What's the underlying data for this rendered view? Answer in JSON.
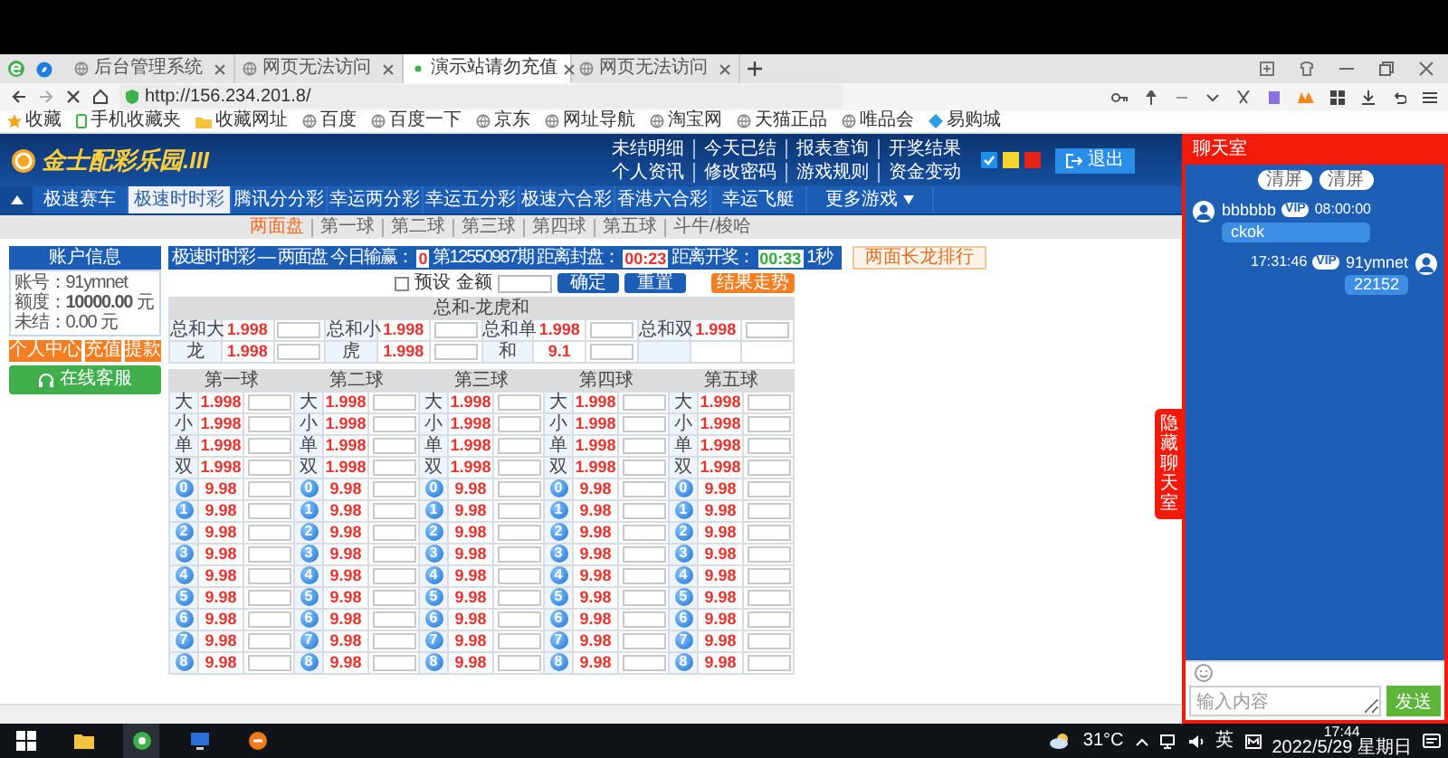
{
  "browser": {
    "tabs": [
      {
        "title": "后台管理系统",
        "selected": false
      },
      {
        "title": "网页无法访问",
        "selected": false
      },
      {
        "title": "演示站请勿充值",
        "selected": true
      },
      {
        "title": "网页无法访问",
        "selected": false
      }
    ],
    "url": "http://156.234.201.8/",
    "bookmarks": [
      "收藏",
      "手机收藏夹",
      "收藏网址",
      "百度",
      "百度一下",
      "京东",
      "网址导航",
      "淘宝网",
      "天猫正品",
      "唯品会",
      "易购城"
    ]
  },
  "header": {
    "logo": "金士配彩乐园.III",
    "links": [
      [
        "未结明细",
        "今天已结",
        "报表查询",
        "开奖结果"
      ],
      [
        "个人资讯",
        "修改密码",
        "游戏规则",
        "资金变动"
      ]
    ],
    "themes": [
      {
        "color": "#1e8fe8",
        "selected": true
      },
      {
        "color": "#f5d631",
        "selected": false
      },
      {
        "color": "#e2231a",
        "selected": false
      }
    ],
    "logout": "退出"
  },
  "nav": [
    {
      "label": "极速赛车",
      "kind": "link",
      "selected": false
    },
    {
      "label": "极速时时彩",
      "kind": "link",
      "selected": true
    },
    {
      "label": "腾讯分分彩",
      "kind": "link",
      "selected": false
    },
    {
      "label": "幸运两分彩",
      "kind": "link",
      "selected": false
    },
    {
      "label": "幸运五分彩",
      "kind": "link",
      "selected": false
    },
    {
      "label": "极速六合彩",
      "kind": "link",
      "selected": false
    },
    {
      "label": "香港六合彩",
      "kind": "link",
      "selected": false
    },
    {
      "label": "幸运飞艇",
      "kind": "link",
      "selected": false
    },
    {
      "label": "更多游戏",
      "kind": "dropdown",
      "selected": false
    }
  ],
  "subnav": [
    {
      "label": "两面盘",
      "selected": true
    },
    {
      "label": "第一球",
      "selected": false
    },
    {
      "label": "第二球",
      "selected": false
    },
    {
      "label": "第三球",
      "selected": false
    },
    {
      "label": "第四球",
      "selected": false
    },
    {
      "label": "第五球",
      "selected": false
    },
    {
      "label": "斗牛/梭哈",
      "selected": false
    }
  ],
  "account": {
    "title": "账户信息",
    "fields": [
      "账号：91ymnet",
      "额度：**10000.00** 元",
      "未结：0.00 元"
    ],
    "buttons": [
      "个人中心",
      "充值",
      "提款"
    ],
    "service": "在线客服"
  },
  "game": {
    "title": "极速时时彩 — 两面盘",
    "today_label": "今日输赢：",
    "today_value": "0",
    "period": "第12550987期 距离封盘：",
    "close_timer": "00:23",
    "draw_label": "距离开奖：",
    "draw_timer": "00:33",
    "refresh": "1秒",
    "ranking_button": "两面长龙排行",
    "preset": {
      "label": "预设",
      "checked": false
    },
    "amount_label": "金额",
    "confirm": "确定",
    "reset": "重置",
    "trend": "结果走势"
  },
  "sum_table": {
    "title": "总和-龙虎和",
    "rows": [
      [
        {
          "label": "总和大",
          "odds": "1.998"
        },
        {
          "label": "总和小",
          "odds": "1.998"
        },
        {
          "label": "总和单",
          "odds": "1.998"
        },
        {
          "label": "总和双",
          "odds": "1.998"
        }
      ],
      [
        {
          "label": "龙",
          "odds": "1.998"
        },
        {
          "label": "虎",
          "odds": "1.998"
        },
        {
          "label": "和",
          "odds": "9.1"
        }
      ]
    ]
  },
  "balls": [
    {
      "title": "第一球",
      "rows": [
        {
          "kind": "text",
          "label": "大",
          "odds": "1.998"
        },
        {
          "kind": "text",
          "label": "小",
          "odds": "1.998"
        },
        {
          "kind": "text",
          "label": "单",
          "odds": "1.998"
        },
        {
          "kind": "text",
          "label": "双",
          "odds": "1.998"
        },
        {
          "kind": "ball",
          "label": "0",
          "odds": "9.98"
        },
        {
          "kind": "ball",
          "label": "1",
          "odds": "9.98"
        },
        {
          "kind": "ball",
          "label": "2",
          "odds": "9.98"
        },
        {
          "kind": "ball",
          "label": "3",
          "odds": "9.98"
        },
        {
          "kind": "ball",
          "label": "4",
          "odds": "9.98"
        },
        {
          "kind": "ball",
          "label": "5",
          "odds": "9.98"
        },
        {
          "kind": "ball",
          "label": "6",
          "odds": "9.98"
        },
        {
          "kind": "ball",
          "label": "7",
          "odds": "9.98"
        },
        {
          "kind": "ball",
          "label": "8",
          "odds": "9.98"
        }
      ]
    },
    {
      "title": "第二球",
      "rows": [
        {
          "kind": "text",
          "label": "大",
          "odds": "1.998"
        },
        {
          "kind": "text",
          "label": "小",
          "odds": "1.998"
        },
        {
          "kind": "text",
          "label": "单",
          "odds": "1.998"
        },
        {
          "kind": "text",
          "label": "双",
          "odds": "1.998"
        },
        {
          "kind": "ball",
          "label": "0",
          "odds": "9.98"
        },
        {
          "kind": "ball",
          "label": "1",
          "odds": "9.98"
        },
        {
          "kind": "ball",
          "label": "2",
          "odds": "9.98"
        },
        {
          "kind": "ball",
          "label": "3",
          "odds": "9.98"
        },
        {
          "kind": "ball",
          "label": "4",
          "odds": "9.98"
        },
        {
          "kind": "ball",
          "label": "5",
          "odds": "9.98"
        },
        {
          "kind": "ball",
          "label": "6",
          "odds": "9.98"
        },
        {
          "kind": "ball",
          "label": "7",
          "odds": "9.98"
        },
        {
          "kind": "ball",
          "label": "8",
          "odds": "9.98"
        }
      ]
    },
    {
      "title": "第三球",
      "rows": [
        {
          "kind": "text",
          "label": "大",
          "odds": "1.998"
        },
        {
          "kind": "text",
          "label": "小",
          "odds": "1.998"
        },
        {
          "kind": "text",
          "label": "单",
          "odds": "1.998"
        },
        {
          "kind": "text",
          "label": "双",
          "odds": "1.998"
        },
        {
          "kind": "ball",
          "label": "0",
          "odds": "9.98"
        },
        {
          "kind": "ball",
          "label": "1",
          "odds": "9.98"
        },
        {
          "kind": "ball",
          "label": "2",
          "odds": "9.98"
        },
        {
          "kind": "ball",
          "label": "3",
          "odds": "9.98"
        },
        {
          "kind": "ball",
          "label": "4",
          "odds": "9.98"
        },
        {
          "kind": "ball",
          "label": "5",
          "odds": "9.98"
        },
        {
          "kind": "ball",
          "label": "6",
          "odds": "9.98"
        },
        {
          "kind": "ball",
          "label": "7",
          "odds": "9.98"
        },
        {
          "kind": "ball",
          "label": "8",
          "odds": "9.98"
        }
      ]
    },
    {
      "title": "第四球",
      "rows": [
        {
          "kind": "text",
          "label": "大",
          "odds": "1.998"
        },
        {
          "kind": "text",
          "label": "小",
          "odds": "1.998"
        },
        {
          "kind": "text",
          "label": "单",
          "odds": "1.998"
        },
        {
          "kind": "text",
          "label": "双",
          "odds": "1.998"
        },
        {
          "kind": "ball",
          "label": "0",
          "odds": "9.98"
        },
        {
          "kind": "ball",
          "label": "1",
          "odds": "9.98"
        },
        {
          "kind": "ball",
          "label": "2",
          "odds": "9.98"
        },
        {
          "kind": "ball",
          "label": "3",
          "odds": "9.98"
        },
        {
          "kind": "ball",
          "label": "4",
          "odds": "9.98"
        },
        {
          "kind": "ball",
          "label": "5",
          "odds": "9.98"
        },
        {
          "kind": "ball",
          "label": "6",
          "odds": "9.98"
        },
        {
          "kind": "ball",
          "label": "7",
          "odds": "9.98"
        },
        {
          "kind": "ball",
          "label": "8",
          "odds": "9.98"
        }
      ]
    },
    {
      "title": "第五球",
      "rows": [
        {
          "kind": "text",
          "label": "大",
          "odds": "1.998"
        },
        {
          "kind": "text",
          "label": "小",
          "odds": "1.998"
        },
        {
          "kind": "text",
          "label": "单",
          "odds": "1.998"
        },
        {
          "kind": "text",
          "label": "双",
          "odds": "1.998"
        },
        {
          "kind": "ball",
          "label": "0",
          "odds": "9.98"
        },
        {
          "kind": "ball",
          "label": "1",
          "odds": "9.98"
        },
        {
          "kind": "ball",
          "label": "2",
          "odds": "9.98"
        },
        {
          "kind": "ball",
          "label": "3",
          "odds": "9.98"
        },
        {
          "kind": "ball",
          "label": "4",
          "odds": "9.98"
        },
        {
          "kind": "ball",
          "label": "5",
          "odds": "9.98"
        },
        {
          "kind": "ball",
          "label": "6",
          "odds": "9.98"
        },
        {
          "kind": "ball",
          "label": "7",
          "odds": "9.98"
        },
        {
          "kind": "ball",
          "label": "8",
          "odds": "9.98"
        }
      ]
    }
  ],
  "chat": {
    "title": "聊天室",
    "buttons": [
      "清屏",
      "清屏"
    ],
    "messages": [
      {
        "kind": "incoming",
        "name": "bbbbbb",
        "badge": "VIP",
        "time": "08:00:00",
        "text": "ckok"
      },
      {
        "kind": "outgoing",
        "name": "91ymnet",
        "badge": "VIP",
        "time": "17:31:46",
        "text": "22152"
      }
    ],
    "toggle": "隐藏聊天室",
    "placeholder": "输入内容",
    "send": "发送"
  },
  "taskbar": {
    "weather": "31°C",
    "ime": "英",
    "time": "17:44",
    "date": "2022/5/29 星期日"
  }
}
